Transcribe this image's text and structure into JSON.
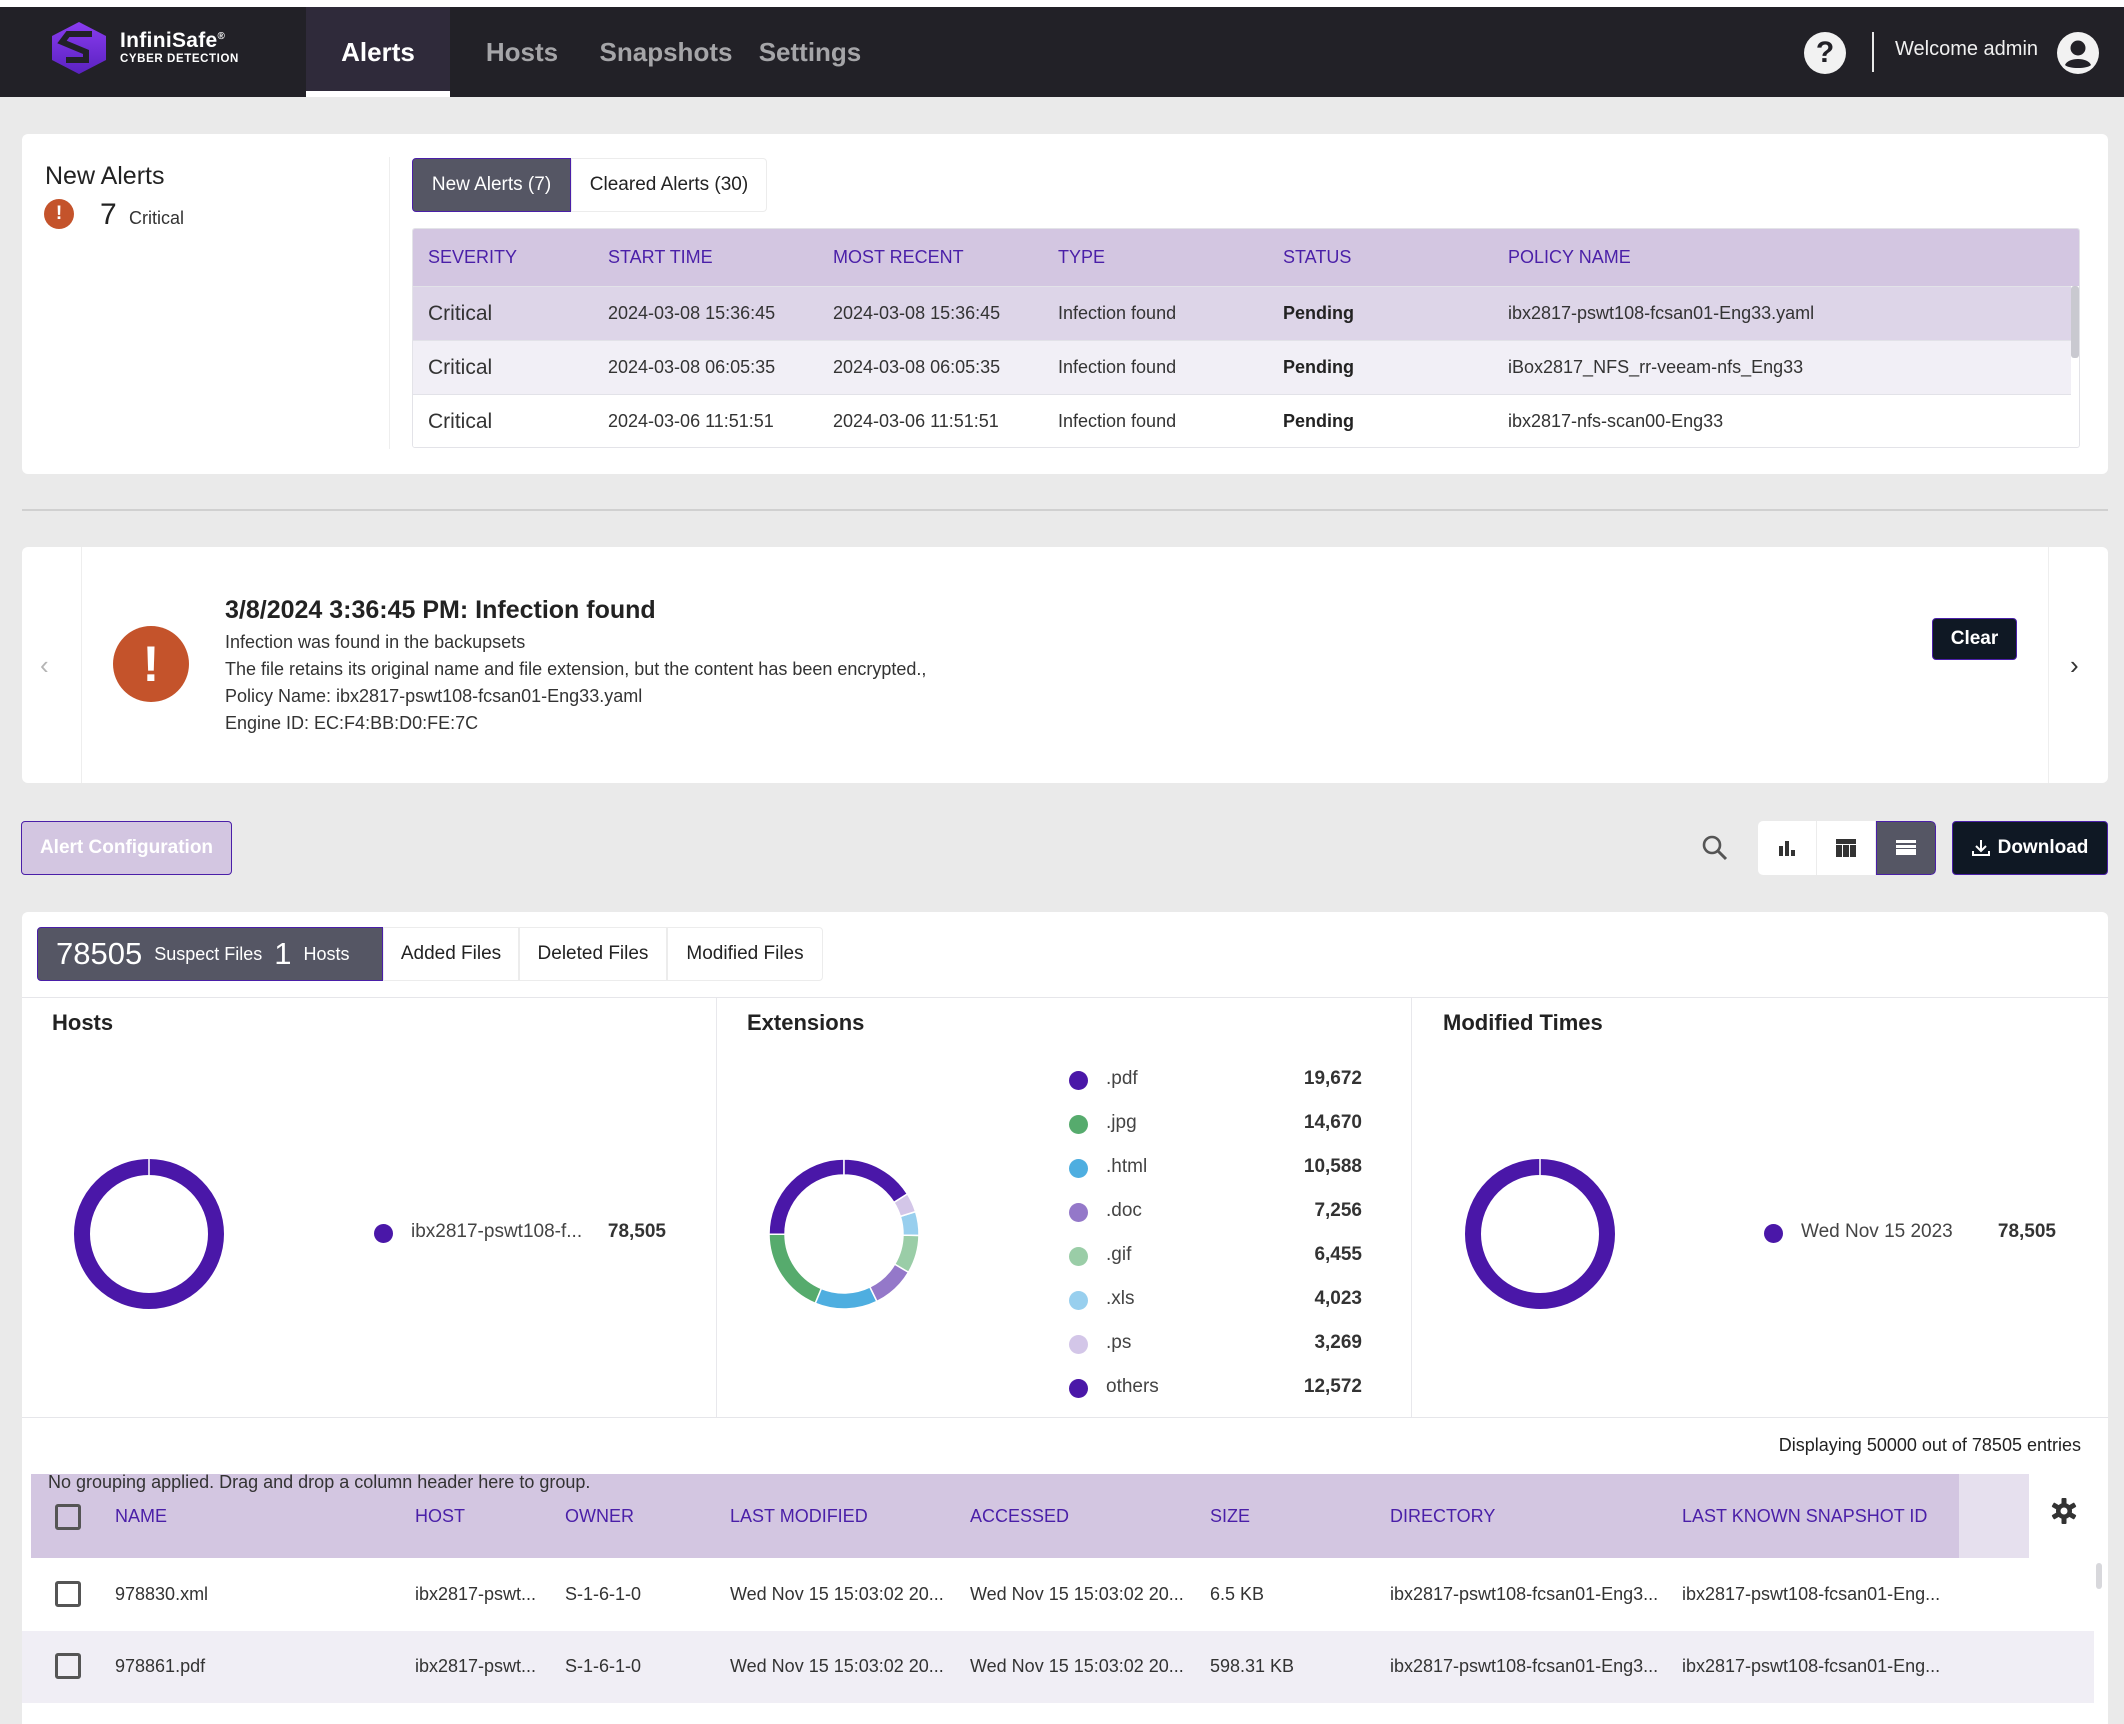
{
  "app": {
    "logo_name": "InfiniSafe",
    "logo_mark": "®",
    "logo_subtitle": "CYBER DETECTION"
  },
  "nav": {
    "items": [
      {
        "label": "Alerts",
        "active": true
      },
      {
        "label": "Hosts",
        "active": false
      },
      {
        "label": "Snapshots",
        "active": false
      },
      {
        "label": "Settings",
        "active": false
      }
    ],
    "help_icon": "?",
    "welcome": "Welcome admin"
  },
  "summary": {
    "title": "New Alerts",
    "count": "7",
    "severity_label": "Critical",
    "icon": "!"
  },
  "alert_tabs": [
    {
      "label": "New Alerts (7)",
      "active": true
    },
    {
      "label": "Cleared Alerts (30)",
      "active": false
    }
  ],
  "alerts_table": {
    "columns": [
      "SEVERITY",
      "START TIME",
      "MOST RECENT",
      "TYPE",
      "STATUS",
      "POLICY NAME"
    ],
    "rows": [
      [
        "Critical",
        "2024-03-08 15:36:45",
        "2024-03-08 15:36:45",
        "Infection found",
        "Pending",
        "ibx2817-pswt108-fcsan01-Eng33.yaml"
      ],
      [
        "Critical",
        "2024-03-08 06:05:35",
        "2024-03-08 06:05:35",
        "Infection found",
        "Pending",
        "iBox2817_NFS_rr-veeam-nfs_Eng33"
      ],
      [
        "Critical",
        "2024-03-06 11:51:51",
        "2024-03-06 11:51:51",
        "Infection found",
        "Pending",
        "ibx2817-nfs-scan00-Eng33"
      ]
    ]
  },
  "alert_detail": {
    "title": "3/8/2024 3:36:45 PM: Infection found",
    "lines": [
      "Infection was found in the backupsets",
      "The file retains its original name and file extension, but the content has been encrypted.,",
      "Policy Name: ibx2817-pswt108-fcsan01-Eng33.yaml",
      "Engine ID: EC:F4:BB:D0:FE:7C"
    ],
    "clear_label": "Clear",
    "prev_icon": "‹",
    "next_icon": "›",
    "icon": "!"
  },
  "toolbar": {
    "alert_config_label": "Alert Configuration",
    "download_label": "Download",
    "view_modes": [
      "chart-view",
      "table-view",
      "list-view"
    ],
    "active_view": "list-view"
  },
  "file_tabs": {
    "suspect_count": "78505",
    "suspect_label": "Suspect Files",
    "hosts_count": "1",
    "hosts_label": "Hosts",
    "added": "Added Files",
    "deleted": "Deleted Files",
    "modified": "Modified Files"
  },
  "colors": {
    "accent": "#4a1fa8",
    "critical": "#c4532b",
    "header_bg": "#d3c6e1",
    "topbar": "#222127"
  },
  "chart_data": [
    {
      "type": "pie",
      "title": "Hosts",
      "donut": true,
      "categories": [
        "ibx2817-pswt108-f..."
      ],
      "values": [
        78505
      ],
      "value_labels": [
        "78,505"
      ],
      "colors": [
        "#4a17a8"
      ],
      "legend": "right"
    },
    {
      "type": "pie",
      "title": "Extensions",
      "donut": true,
      "direction": "counterclockwise",
      "categories": [
        ".pdf",
        ".jpg",
        ".html",
        ".doc",
        ".gif",
        ".xls",
        ".ps",
        "others"
      ],
      "values": [
        19672,
        14670,
        10588,
        7256,
        6455,
        4023,
        3269,
        12572
      ],
      "value_labels": [
        "19,672",
        "14,670",
        "10,588",
        "7,256",
        "6,455",
        "4,023",
        "3,269",
        "12,572"
      ],
      "colors": [
        "#4a17a8",
        "#56ab6d",
        "#4eaee0",
        "#9478c9",
        "#9acda7",
        "#98cfee",
        "#d3c6e8",
        "#4a17a8"
      ],
      "legend": "right"
    },
    {
      "type": "pie",
      "title": "Modified Times",
      "donut": true,
      "categories": [
        "Wed Nov 15 2023"
      ],
      "values": [
        78505
      ],
      "value_labels": [
        "78,505"
      ],
      "colors": [
        "#4a17a8"
      ],
      "legend": "right"
    }
  ],
  "files_grid": {
    "displaying": "Displaying 50000 out of 78505 entries",
    "group_hint": "No grouping applied. Drag and drop a column header here to group.",
    "columns": [
      "NAME",
      "HOST",
      "OWNER",
      "LAST MODIFIED",
      "ACCESSED",
      "SIZE",
      "DIRECTORY",
      "LAST KNOWN SNAPSHOT ID"
    ],
    "rows": [
      [
        "978830.xml",
        "ibx2817-pswt...",
        "S-1-6-1-0",
        "Wed Nov 15 15:03:02 20...",
        "Wed Nov 15 15:03:02 20...",
        "6.5 KB",
        "ibx2817-pswt108-fcsan01-Eng3...",
        "ibx2817-pswt108-fcsan01-Eng..."
      ],
      [
        "978861.pdf",
        "ibx2817-pswt...",
        "S-1-6-1-0",
        "Wed Nov 15 15:03:02 20...",
        "Wed Nov 15 15:03:02 20...",
        "598.31 KB",
        "ibx2817-pswt108-fcsan01-Eng3...",
        "ibx2817-pswt108-fcsan01-Eng..."
      ]
    ]
  }
}
